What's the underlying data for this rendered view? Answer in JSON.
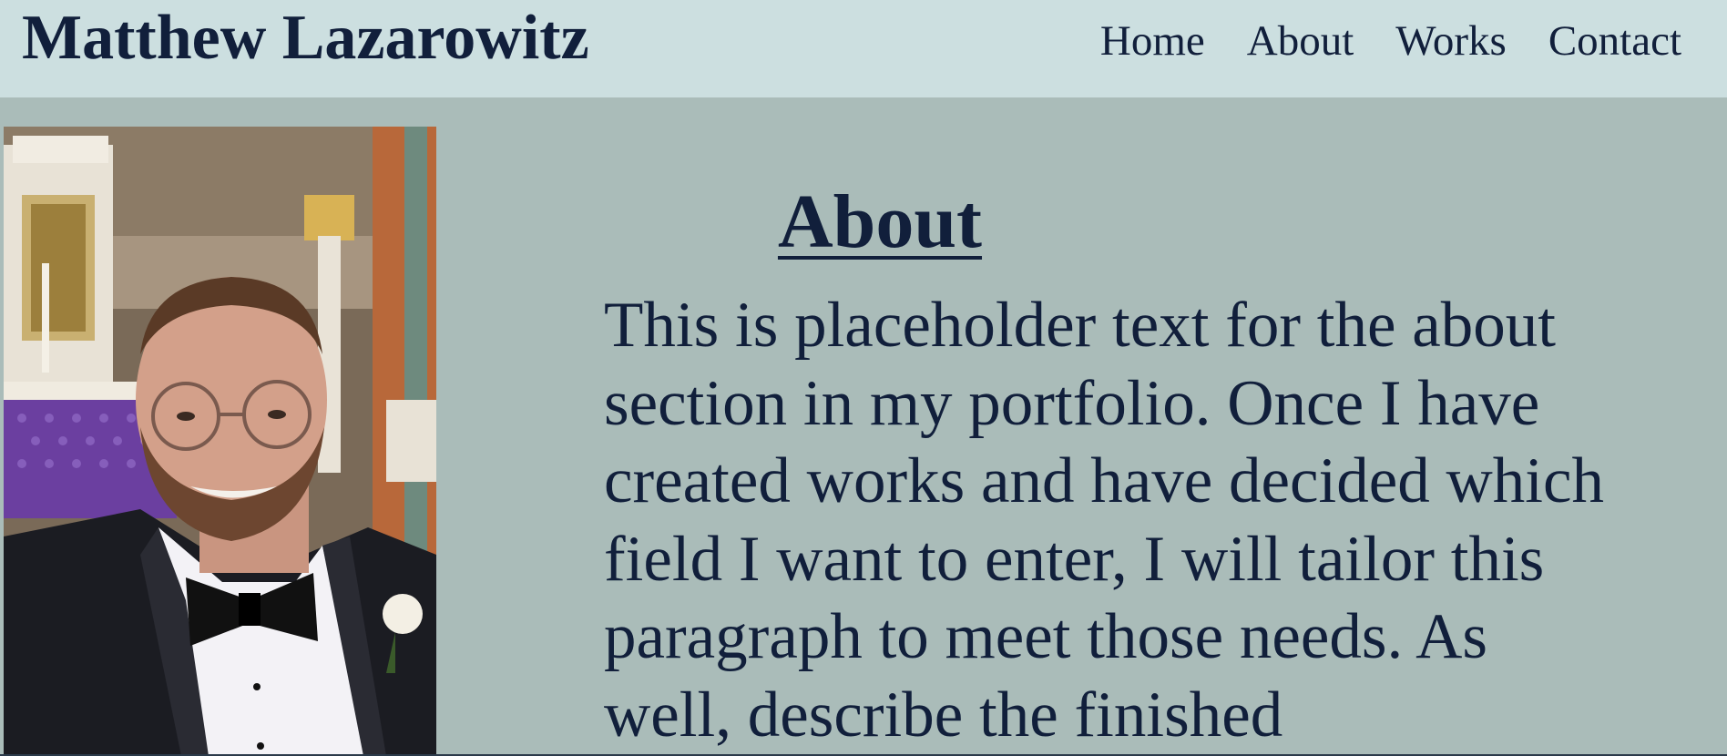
{
  "header": {
    "title": "Matthew Lazarowitz",
    "nav": [
      {
        "label": "Home"
      },
      {
        "label": "About"
      },
      {
        "label": "Works"
      },
      {
        "label": "Contact"
      }
    ]
  },
  "main": {
    "heading": "About",
    "paragraph": "This is placeholder text for the about section in my portfolio. Once I have created works and have decided which field I want to enter, I will tailor this paragraph to meet those needs. As well, describe the finished"
  },
  "colors": {
    "header_bg": "#ccdfe0",
    "page_bg": "#aabcb9",
    "text": "#111f3b"
  }
}
